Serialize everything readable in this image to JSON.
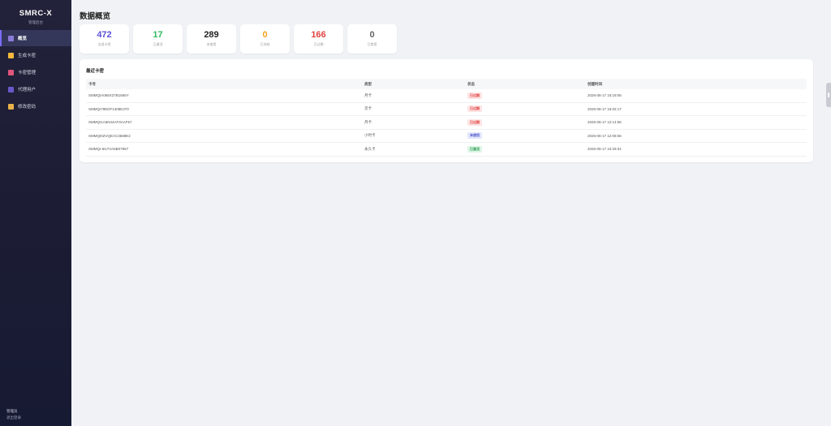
{
  "sidebar": {
    "brand_title": "SMRC-X",
    "brand_sub": "管理后台",
    "items": [
      {
        "label": "概览",
        "icon": "chart-icon",
        "color": "#8a7ad8",
        "active": true
      },
      {
        "label": "生成卡密",
        "icon": "sparkle-icon",
        "color": "#f5b83d",
        "active": false
      },
      {
        "label": "卡密管理",
        "icon": "card-icon",
        "color": "#e0567b",
        "active": false
      },
      {
        "label": "代理用户",
        "icon": "users-icon",
        "color": "#6a58c9",
        "active": false
      },
      {
        "label": "修改密码",
        "icon": "key-icon",
        "color": "#e8b248",
        "active": false
      }
    ],
    "footer_user": "管理员",
    "footer_logout": "退出登录"
  },
  "page_title": "数据概览",
  "stats": [
    {
      "value": "472",
      "label": "全部卡密",
      "color": "#5b4fd9"
    },
    {
      "value": "17",
      "label": "已激活",
      "color": "#2dbb5d"
    },
    {
      "value": "289",
      "label": "未使用",
      "color": "#222222"
    },
    {
      "value": "0",
      "label": "已冻结",
      "color": "#f0a31d"
    },
    {
      "value": "166",
      "label": "已过期",
      "color": "#e0423f"
    },
    {
      "value": "0",
      "label": "已禁用",
      "color": "#666666"
    }
  ],
  "recent": {
    "title": "最近卡密",
    "headers": [
      "卡号",
      "类型",
      "状态",
      "创建时间"
    ],
    "rows": [
      {
        "card": "SMMQIA066X37B1665Y",
        "type": "月卡",
        "status": "已过期",
        "status_kind": "expired",
        "time": "2026-06-17 16:19:06"
      },
      {
        "card": "SMMQI79EDF1408E370",
        "type": "次卡",
        "status": "已过期",
        "status_kind": "expired",
        "time": "2026-06-17 15:02:17"
      },
      {
        "card": "SMMQI1A6N44AF3AAF57",
        "type": "月卡",
        "status": "已过期",
        "status_kind": "expired",
        "time": "2026-06-17 12:14:56"
      },
      {
        "card": "SMMQI0ZVQEAC3688E2",
        "type": "小时卡",
        "status": "未使用",
        "status_kind": "unused",
        "time": "2026-06-17 12:08:56"
      },
      {
        "card": "SMMQI-6ILTVA5B07957",
        "type": "永久卡",
        "status": "已激活",
        "status_kind": "activated",
        "time": "2026-06-17 10:29:31"
      }
    ]
  }
}
